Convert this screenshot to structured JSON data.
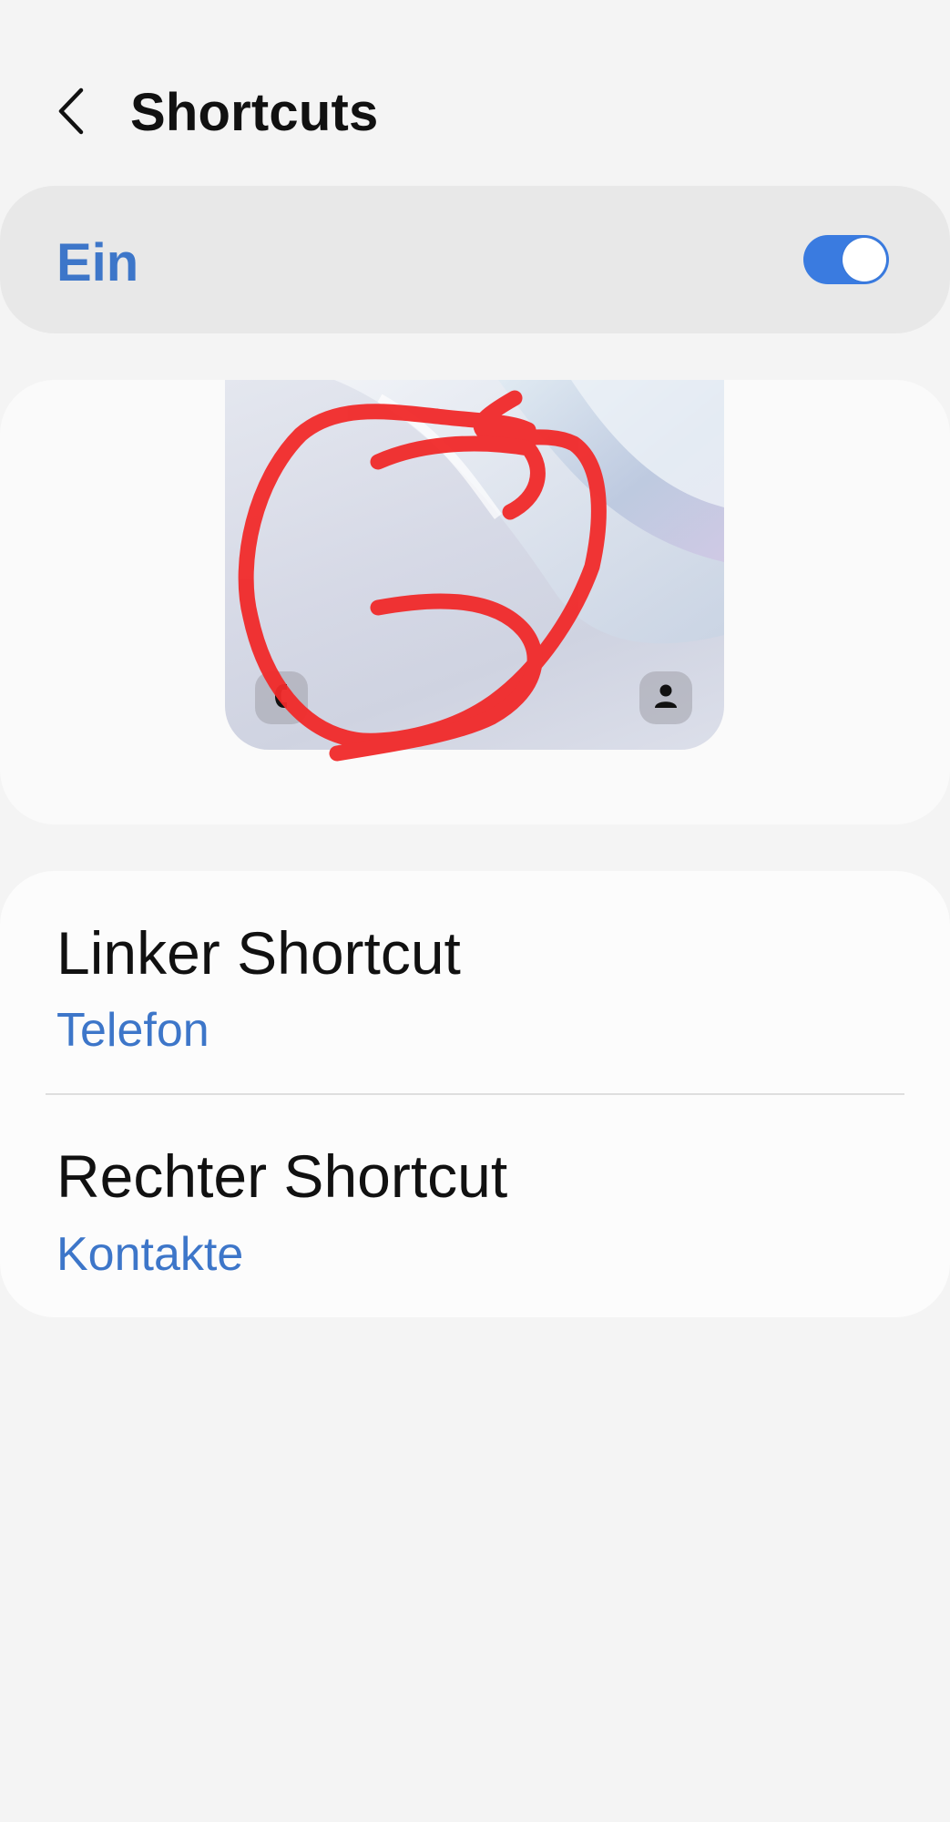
{
  "header": {
    "title": "Shortcuts",
    "back_icon": "chevron-left-icon"
  },
  "master_switch": {
    "label": "Ein",
    "state": "on",
    "accent_color": "#3a7be0",
    "label_color": "#3d76c9"
  },
  "preview": {
    "left_shortcut_icon": "phone-icon",
    "right_shortcut_icon": "contact-person-icon",
    "annotation_color": "#f12a2a"
  },
  "options": [
    {
      "title": "Linker Shortcut",
      "value": "Telefon"
    },
    {
      "title": "Rechter Shortcut",
      "value": "Kontakte"
    }
  ]
}
